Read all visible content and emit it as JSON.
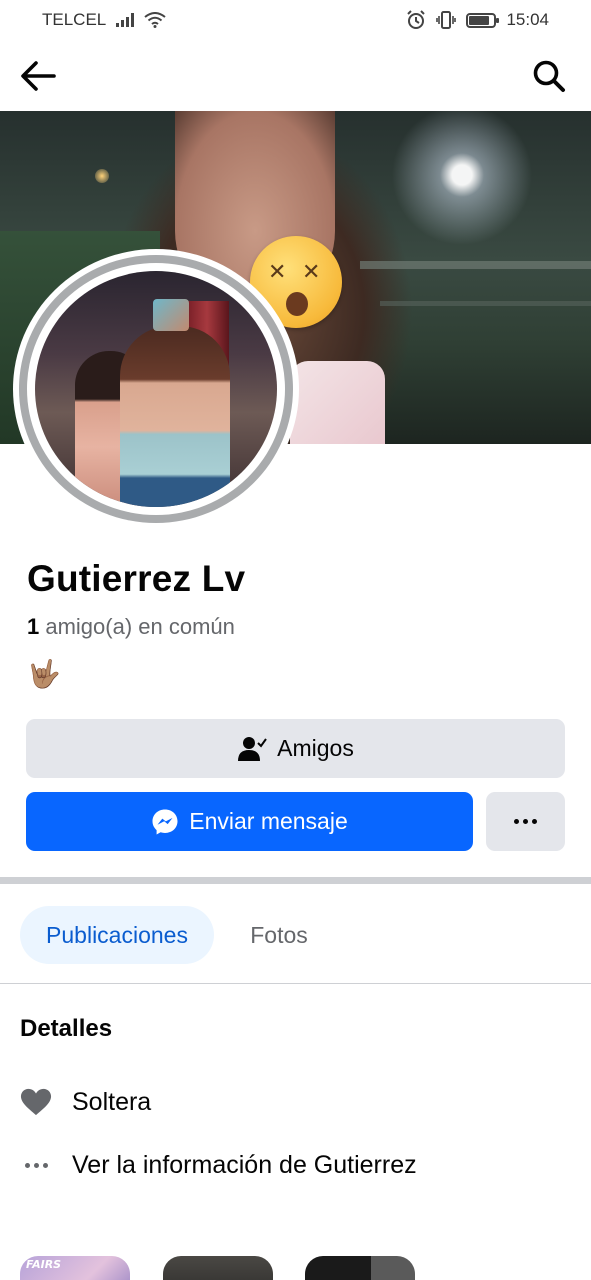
{
  "status_bar": {
    "carrier": "TELCEL",
    "time": "15:04",
    "icons": [
      "signal-icon",
      "wifi-icon",
      "alarm-icon",
      "vibrate-icon",
      "battery-icon"
    ]
  },
  "header": {
    "icons": [
      "back-arrow-icon",
      "search-icon"
    ]
  },
  "cover": {
    "sticker_icon": "dizzy-face-emoji"
  },
  "profile": {
    "name": "Gutierrez Lv",
    "mutual_count": "1",
    "mutual_label": " amigo(a) en común",
    "bio_emoji": "🤟🏽"
  },
  "actions": {
    "friends_label": "Amigos",
    "friends_icon": "friend-check-icon",
    "message_label": "Enviar mensaje",
    "message_icon": "messenger-icon",
    "more_icon": "more-dots-icon"
  },
  "tabs": [
    {
      "label": "Publicaciones",
      "active": true
    },
    {
      "label": "Fotos",
      "active": false
    }
  ],
  "details": {
    "title": "Detalles",
    "items": [
      {
        "icon": "heart-icon",
        "text": "Soltera"
      },
      {
        "icon": "more-dots-icon",
        "text": "Ver la información de Gutierrez"
      }
    ]
  },
  "thumbnails": {
    "first_label": "FAIRS"
  },
  "colors": {
    "accent": "#0866ff",
    "tab_active_bg": "#ebf5ff",
    "tab_active_text": "#0a5ccf",
    "button_gray": "#e4e6eb",
    "secondary_text": "#65676b"
  }
}
